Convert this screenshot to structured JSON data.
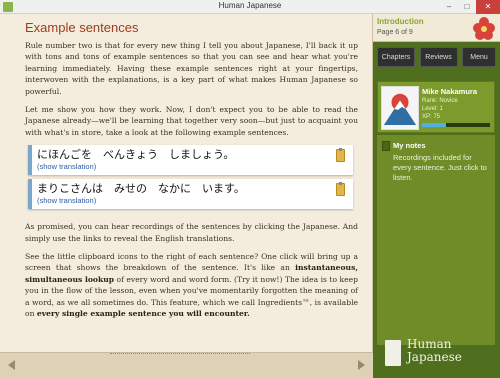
{
  "window": {
    "title": "Human Japanese",
    "minimize": "–",
    "maximize": "□",
    "close": "✕"
  },
  "content": {
    "heading": "Example sentences",
    "para1": "Rule number two is that for every new thing I tell you about Japanese, I'll back it up with tons and tons of example sentences so that you can see and hear what you're learning immediately. Having these example sentences right at your fingertips, interwoven with the explanations, is a key part of what makes Human Japanese so powerful.",
    "para2": "Let me show you how they work. Now, I don't expect you to be able to read the Japanese already—we'll be learning that together very soon—but just to acquaint you with what's in store, take a look at the following example sentences.",
    "examples": [
      {
        "jp": "にほんごを　べんきょう　しましょう。",
        "link": "(show translation)"
      },
      {
        "jp": "まりこさんは　みせの　なかに　います。",
        "link": "(show translation)"
      }
    ],
    "para3": "As promised, you can hear recordings of the sentences by clicking the Japanese. And simply use the links to reveal the English translations.",
    "para4_a": "See the little clipboard icons to the right of each sentence? One click will bring up a screen that shows the breakdown of the sentence. It's like an ",
    "para4_b": "instantaneous, simultaneous lookup",
    "para4_c": " of every word and word form. (Try it now!) The idea is to keep you in the flow of the lesson, even when you've momentarily forgotten the meaning of a word, as we all sometimes do. This feature, which we call Ingredients™, is available on ",
    "para4_d": "every single example sentence you will encounter."
  },
  "sidebar": {
    "intro_title": "Introduction",
    "intro_page": "Page 6 of 9",
    "tabs": {
      "chapters": "Chapters",
      "reviews": "Reviews",
      "menu": "Menu"
    },
    "user": {
      "name": "Mike Nakamura",
      "rank": "Rank: Novice",
      "level": "Level: 1",
      "xp": "XP: 75",
      "xp_progress": 0.35
    },
    "notes": {
      "title": "My notes",
      "body": "Recordings included for every sentence. Just click to listen."
    },
    "logo": {
      "line1": "Human",
      "line2": "Japanese"
    }
  },
  "colors": {
    "accent": "#9b3d1f",
    "sidebar": "#4f6f1f",
    "link": "#2c5da8"
  }
}
